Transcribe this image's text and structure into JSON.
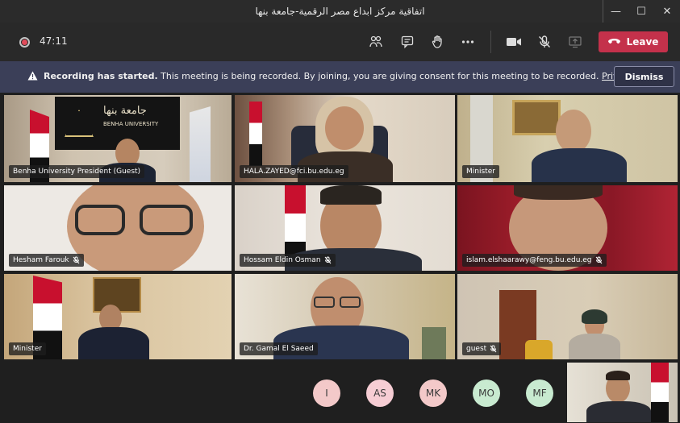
{
  "window": {
    "title": "اتفاقية مركز ابداع مصر الرقمية-جامعة بنها",
    "minimize": "—",
    "maximize": "☐",
    "close": "✕"
  },
  "toolbar": {
    "timer": "47:11",
    "leave_label": "Leave"
  },
  "banner": {
    "bold": "Recording has started.",
    "text": " This meeting is being recorded. By joining, you are giving consent for this meeting to be recorded. ",
    "link": "Privacy policy",
    "dismiss": "Dismiss"
  },
  "tiles": [
    {
      "name": "Benha University President (Guest)",
      "muted": false
    },
    {
      "name": "HALA.ZAYED@fci.bu.edu.eg",
      "muted": false
    },
    {
      "name": "Minister",
      "muted": false
    },
    {
      "name": "Hesham Farouk",
      "muted": true
    },
    {
      "name": "Hossam Eldin Osman",
      "muted": true
    },
    {
      "name": "islam.elshaarawy@feng.bu.edu.eg",
      "muted": true
    },
    {
      "name": "Minister",
      "muted": false
    },
    {
      "name": "Dr. Gamal El Saeed",
      "muted": false
    },
    {
      "name": "guest",
      "muted": true
    }
  ],
  "sign": {
    "arabic": "جامعة بنها",
    "english": "BENHA UNIVERSITY"
  },
  "avatars": [
    {
      "initials": "I",
      "color": "#f3c9c9"
    },
    {
      "initials": "AS",
      "color": "#f6cdd4"
    },
    {
      "initials": "MK",
      "color": "#f3c9c9"
    },
    {
      "initials": "MO",
      "color": "#c8ead0"
    },
    {
      "initials": "MF",
      "color": "#c8ead0"
    }
  ],
  "colors": {
    "leave": "#c4314b",
    "banner": "#3b3f58",
    "app_bg": "#1f1f1f"
  }
}
